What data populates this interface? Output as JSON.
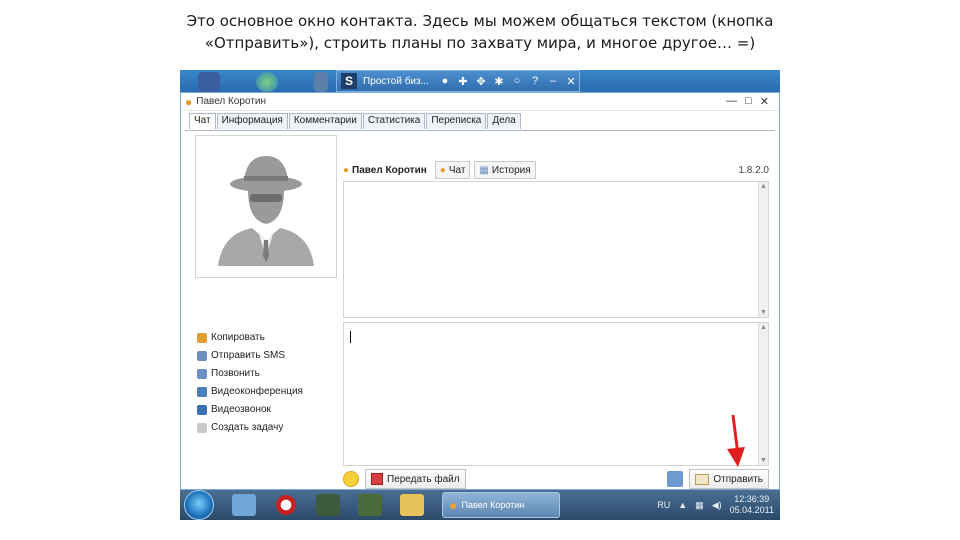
{
  "caption": {
    "line1": "Это основное окно контакта. Здесь мы можем общаться текстом (кнопка",
    "line2": "«Отправить»), строить планы по захвату мира, и многое другое… =)"
  },
  "mini_toolbar": {
    "title": "Простой биз..."
  },
  "window": {
    "title": "Павел Коротин",
    "controls": {
      "minimize": "—",
      "maximize": "□",
      "close": "✕"
    }
  },
  "tabs": [
    "Чат",
    "Информация",
    "Комментарии",
    "Статистика",
    "Переписка",
    "Дела"
  ],
  "actions": [
    {
      "label": "Копировать",
      "icon_color": "#e0a030"
    },
    {
      "label": "Отправить SMS",
      "icon_color": "#6a8fc0"
    },
    {
      "label": "Позвонить",
      "icon_color": "#6a8fc0"
    },
    {
      "label": "Видеоконференция",
      "icon_color": "#4a80c0"
    },
    {
      "label": "Видеозвонок",
      "icon_color": "#3a70b0"
    },
    {
      "label": "Создать задачу",
      "icon_color": "#c8c8c8"
    }
  ],
  "chat_header": {
    "contact_name": "Павел Коротин",
    "chat_button": "Чат",
    "history_button": "История",
    "version": "1.8.2.0"
  },
  "bottom": {
    "send_file": "Передать файл",
    "send": "Отправить"
  },
  "taskbar": {
    "active_task": "Павел Коротин",
    "lang": "RU",
    "time": "12:36:39",
    "date": "05.04.2011"
  },
  "colors": {
    "accent": "#2a6cb0",
    "arrow": "#e02020"
  }
}
